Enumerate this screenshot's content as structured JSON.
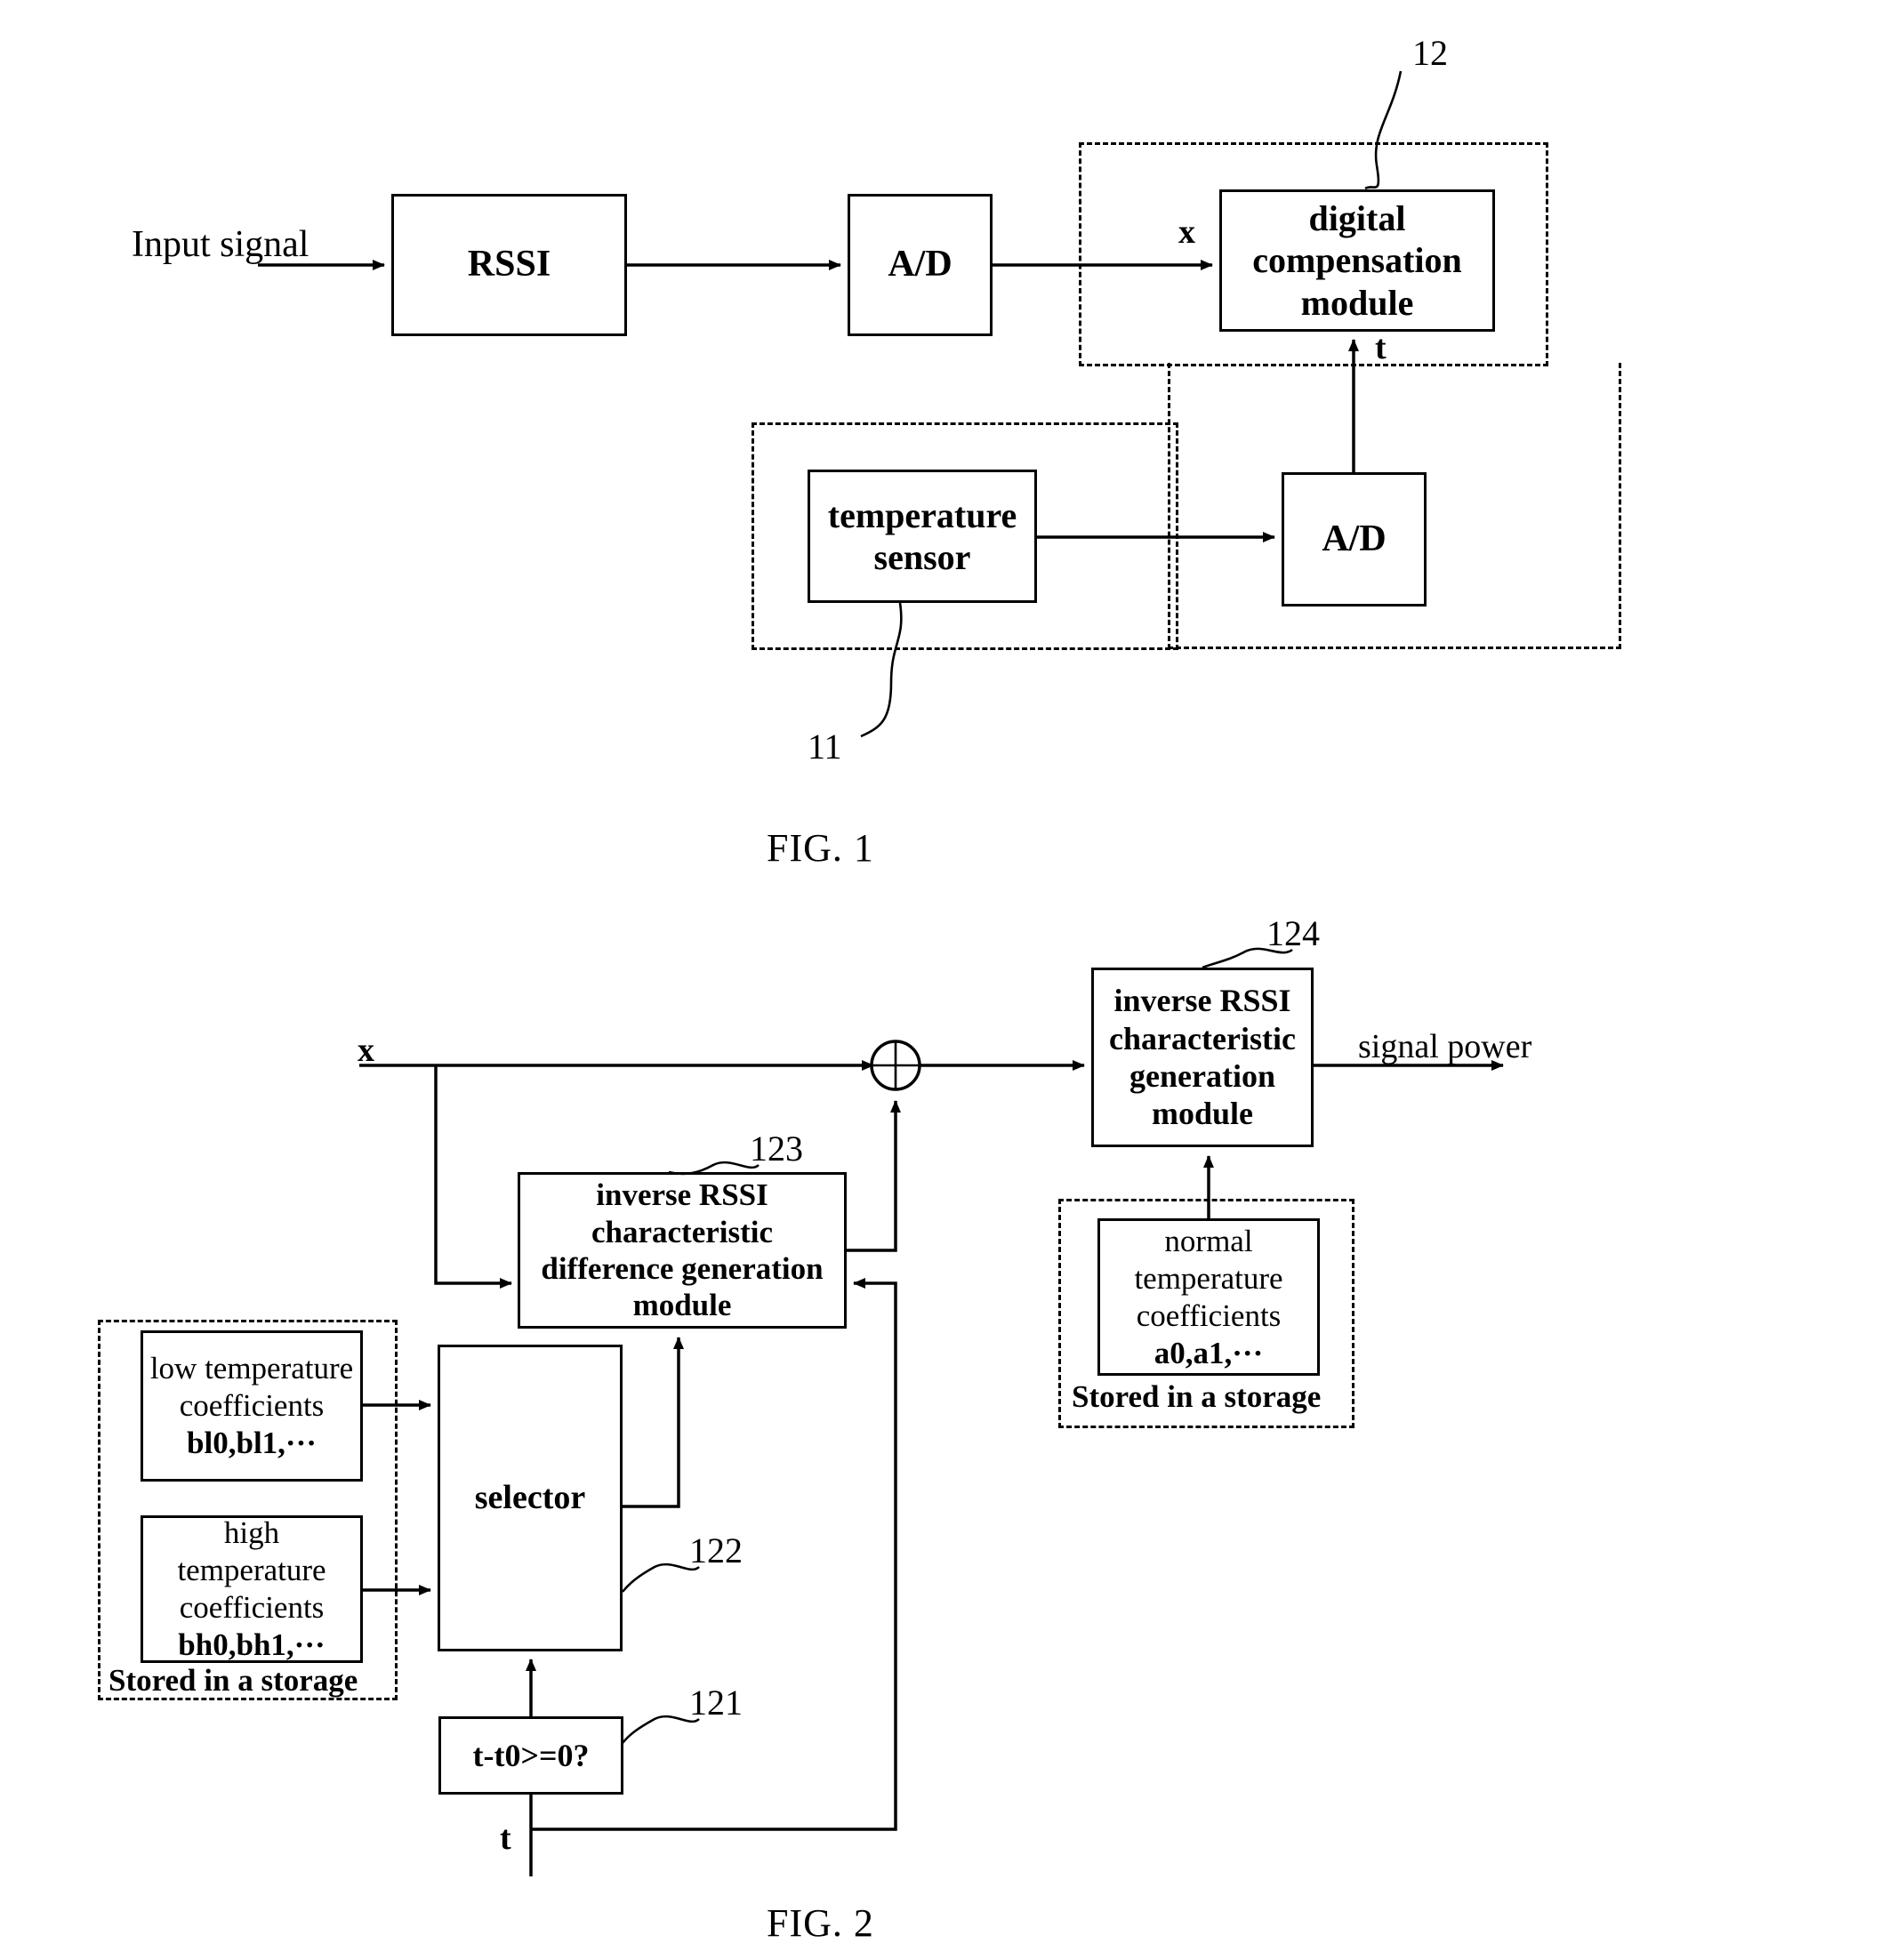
{
  "figures": [
    {
      "caption": "FIG. 1",
      "blocks": {
        "rssi": "RSSI",
        "ad1": "A/D",
        "digital_compensation": "digital compensation module",
        "temperature_sensor": "temperature sensor",
        "ad2": "A/D"
      },
      "labels": {
        "input_signal": "Input signal",
        "x": "x",
        "t": "t",
        "ref_12": "12",
        "ref_11": "11"
      }
    },
    {
      "caption": "FIG. 2",
      "blocks": {
        "inverse_rssi_gen": "inverse RSSI characteristic generation module",
        "inverse_rssi_diff": "inverse RSSI characteristic difference generation module",
        "selector": "selector",
        "comparator": "t-t0>=0?",
        "normal_coeff_title": "normal temperature coefficients",
        "normal_coeff_values": "a0,a1,···",
        "low_coeff_title": "low temperature coefficients",
        "low_coeff_values": "bl0,bl1,···",
        "high_coeff_title": "high temperature coefficients",
        "high_coeff_values": "bh0,bh1,···"
      },
      "labels": {
        "x": "x",
        "t": "t",
        "signal_power": "signal power",
        "stored_right": "Stored in a storage",
        "stored_left": "Stored in a storage",
        "ref_124": "124",
        "ref_123": "123",
        "ref_122": "122",
        "ref_121": "121",
        "adder": "⊕"
      }
    }
  ],
  "colors": {
    "ink": "#000000",
    "paper": "#ffffff"
  }
}
